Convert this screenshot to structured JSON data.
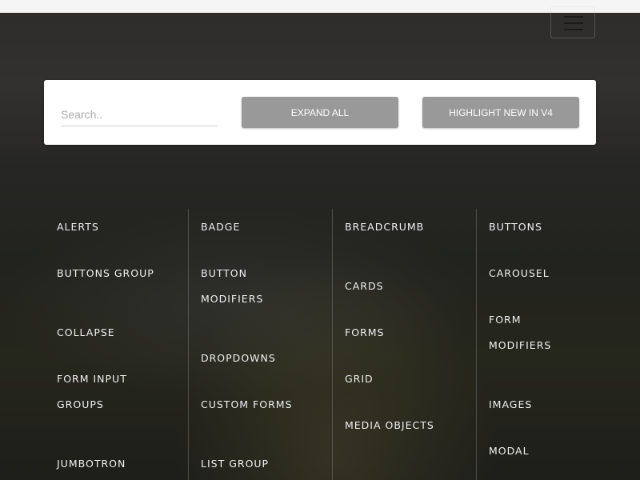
{
  "header": {
    "menu_icon": "hamburger-icon"
  },
  "toolbar": {
    "search_placeholder": "Search..",
    "expand_all": "EXPAND ALL",
    "highlight_new": "HIGHLIGHT NEW IN V4"
  },
  "columns": [
    [
      "ALERTS",
      "BUTTONS GROUP",
      "COLLAPSE",
      "FORM INPUT GROUPS",
      "JUMBOTRON"
    ],
    [
      "BADGE",
      "BUTTON MODIFIERS",
      "DROPDOWNS",
      "CUSTOM FORMS",
      "LIST GROUP"
    ],
    [
      "BREADCRUMB",
      "CARDS",
      "FORMS",
      "GRID",
      "MEDIA OBJECTS"
    ],
    [
      "BUTTONS",
      "CAROUSEL",
      "FORM MODIFIERS",
      "IMAGES",
      "MODAL"
    ]
  ]
}
